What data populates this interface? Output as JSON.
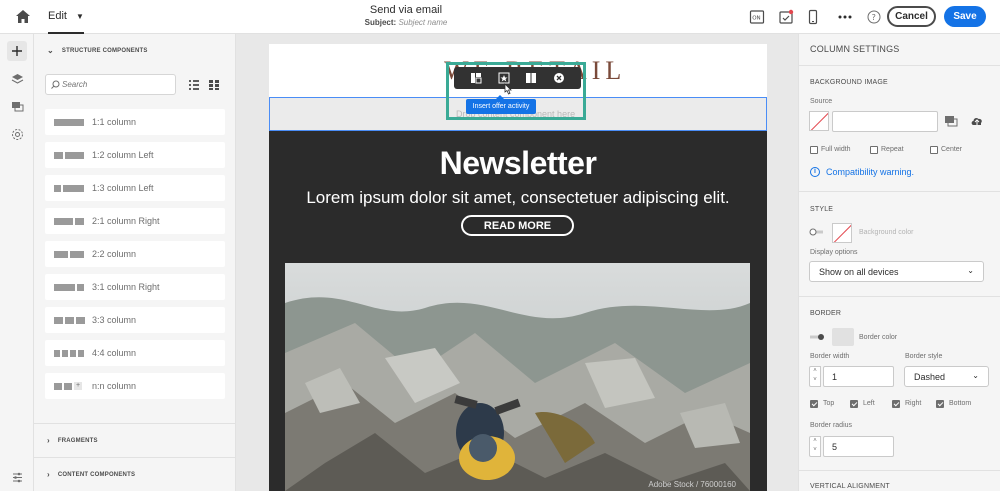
{
  "header": {
    "tab_label": "Edit",
    "title": "Send via email",
    "subject_label": "Subject:",
    "subject_placeholder": "Subject name",
    "cancel_label": "Cancel",
    "save_label": "Save"
  },
  "left_panel": {
    "structure_title": "STRUCTURE COMPONENTS",
    "search_placeholder": "Search",
    "components": [
      {
        "label": "1:1 column"
      },
      {
        "label": "1:2 column Left"
      },
      {
        "label": "1:3 column Left"
      },
      {
        "label": "2:1 column Right"
      },
      {
        "label": "2:2 column"
      },
      {
        "label": "3:1 column Right"
      },
      {
        "label": "3:3 column"
      },
      {
        "label": "4:4 column"
      },
      {
        "label": "n:n column"
      }
    ],
    "fragments_title": "FRAGMENTS",
    "content_title": "CONTENT COMPONENTS"
  },
  "canvas": {
    "logo_text": "WE RETAIL",
    "drop_text": "Drop content component here",
    "tooltip": "Insert offer activity",
    "newsletter_title": "Newsletter",
    "newsletter_subtitle": "Lorem ipsum dolor sit amet, consectetuer adipiscing elit.",
    "read_more": "READ MORE",
    "photo_caption": "Adobe Stock / 76000160"
  },
  "right_panel": {
    "title": "COLUMN SETTINGS",
    "background_image": "BACKGROUND IMAGE",
    "source_label": "Source",
    "full_width": "Full width",
    "repeat": "Repeat",
    "center": "Center",
    "compat_warning": "Compatibility warning.",
    "style_title": "STYLE",
    "background_color": "Background color",
    "display_options_label": "Display options",
    "display_options_value": "Show on all devices",
    "border_title": "BORDER",
    "border_color": "Border color",
    "border_width_label": "Border width",
    "border_width_value": "1",
    "border_style_label": "Border style",
    "border_style_value": "Dashed",
    "top": "Top",
    "left": "Left",
    "right": "Right",
    "bottom": "Bottom",
    "border_radius_label": "Border radius",
    "border_radius_value": "5",
    "vertical_alignment": "VERTICAL ALIGNMENT"
  },
  "colors": {
    "accent": "#1473e6",
    "selection": "#3aaa96",
    "dark_block": "#2b2b2b"
  }
}
